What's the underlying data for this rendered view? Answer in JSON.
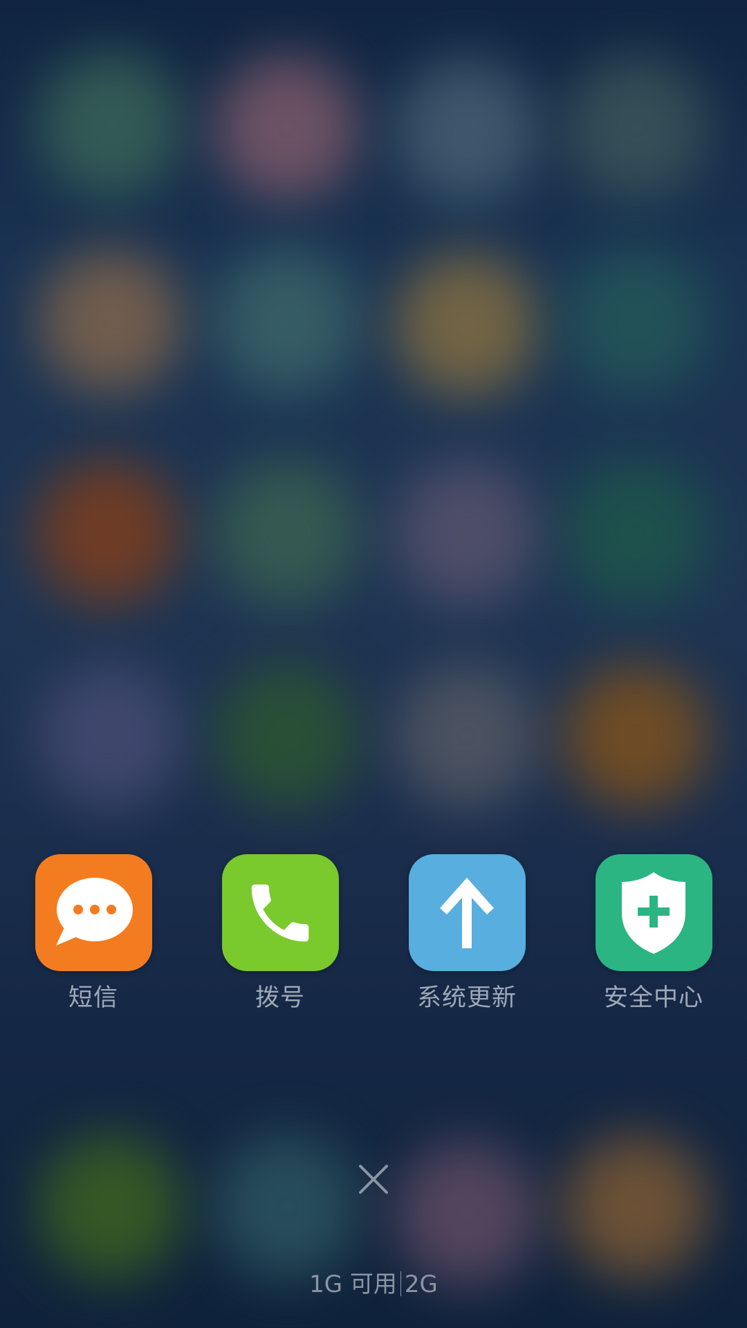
{
  "colors": {
    "sms_tile": "#f47c20",
    "dialer_tile": "#7ac92d",
    "update_tile": "#58aede",
    "security_tile": "#2bb583",
    "label_text": "#9ea8b7"
  },
  "apps": [
    {
      "label": "短信",
      "icon": "chat-bubble-icon"
    },
    {
      "label": "拨号",
      "icon": "phone-handset-icon"
    },
    {
      "label": "系统更新",
      "icon": "up-arrow-icon"
    },
    {
      "label": "安全中心",
      "icon": "shield-plus-icon"
    }
  ],
  "close": {
    "icon": "close-icon"
  },
  "memory": {
    "available": "1G 可用",
    "total": "2G"
  }
}
